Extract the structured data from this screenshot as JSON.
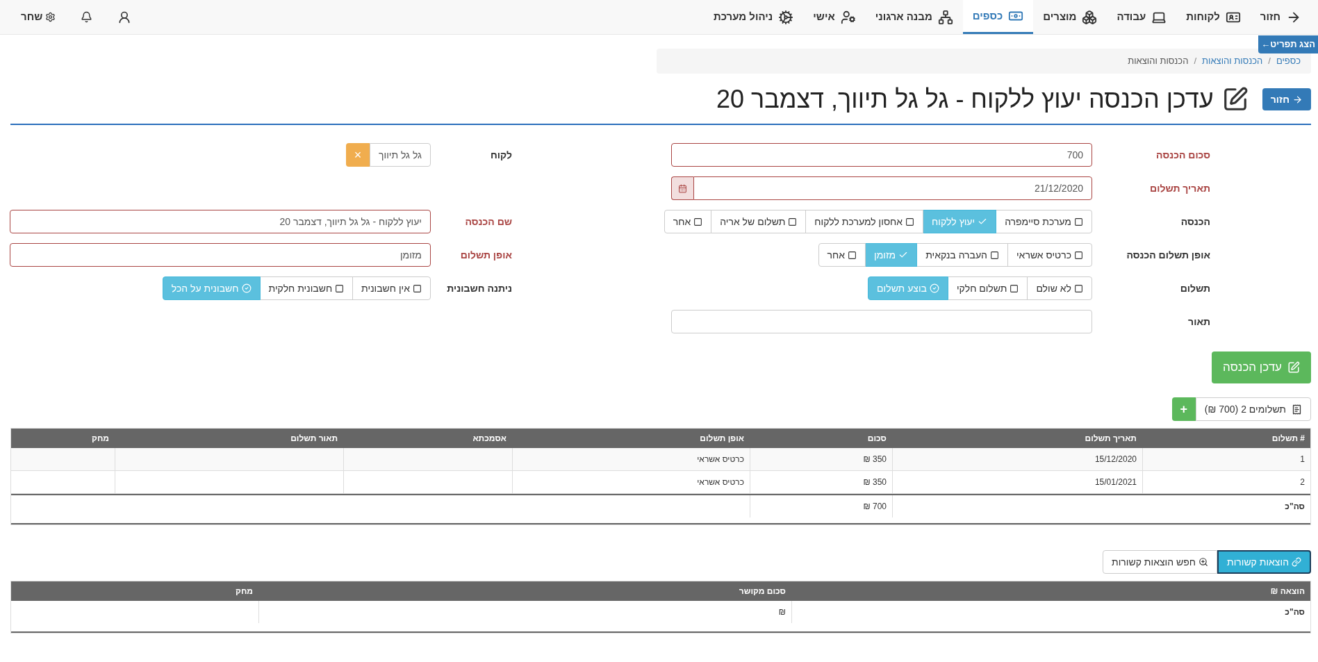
{
  "nav": {
    "items": [
      {
        "label": "חזור",
        "selected": false
      },
      {
        "label": "לקוחות",
        "selected": false
      },
      {
        "label": "עבודה",
        "selected": false
      },
      {
        "label": "מוצרים",
        "selected": false
      },
      {
        "label": "כספים",
        "selected": true
      },
      {
        "label": "מבנה ארגוני",
        "selected": false
      },
      {
        "label": "אישי",
        "selected": false
      },
      {
        "label": "ניהול מערכת",
        "selected": false
      }
    ],
    "user": "שחר"
  },
  "menu_tab": "הצג תפריט←",
  "breadcrumb": {
    "separator": "/",
    "items": [
      "כספים",
      "הכנסות והוצאות",
      "הכנסות והוצאות"
    ]
  },
  "back_button": "חזור",
  "title": "עדכן הכנסה יעוץ ללקוח - גל גל תיווך, דצמבר 20",
  "rows": [
    {
      "right": {
        "label": "סכום הכנסה",
        "required": true,
        "kind": "text",
        "value": "700"
      },
      "left": {
        "label": "לקוח",
        "required": false,
        "kind": "tag",
        "value": "גל גל תיווך",
        "remove": "×"
      }
    },
    {
      "right": {
        "label": "תאריך תשלום",
        "required": true,
        "kind": "date",
        "value": "21/12/2020"
      }
    },
    {
      "right": {
        "label": "הכנסה",
        "required": false,
        "kind": "toggle",
        "options": [
          {
            "label": "מערכת סיימפרה",
            "selected": false
          },
          {
            "label": "יעוץ ללקוח",
            "selected": true
          },
          {
            "label": "אחסון למערכת ללקוח",
            "selected": false
          },
          {
            "label": "תשלום של אריה",
            "selected": false
          },
          {
            "label": "אחר",
            "selected": false
          }
        ]
      },
      "left": {
        "label": "שם הכנסה",
        "required": true,
        "kind": "text",
        "value": "יעוץ ללקוח - גל גל תיווך, דצמבר 20"
      }
    },
    {
      "right": {
        "label": "אופן תשלום הכנסה",
        "required": false,
        "kind": "toggle",
        "options": [
          {
            "label": "כרטיס אשראי",
            "selected": false
          },
          {
            "label": "העברה בנקאית",
            "selected": false
          },
          {
            "label": "מזומן",
            "selected": true
          },
          {
            "label": "אחר",
            "selected": false
          }
        ]
      },
      "left": {
        "label": "אופן תשלום",
        "required": true,
        "kind": "text",
        "value": "מזומן"
      }
    },
    {
      "right": {
        "label": "תשלום",
        "required": false,
        "kind": "status",
        "options": [
          {
            "label": "לא שולם",
            "selected": false
          },
          {
            "label": "תשלום חלקי",
            "selected": false
          },
          {
            "label": "בוצע תשלום",
            "selected": true
          }
        ]
      },
      "left": {
        "label": "ניתנה חשבונית",
        "required": false,
        "kind": "status",
        "options": [
          {
            "label": "אין חשבונית",
            "selected": false
          },
          {
            "label": "חשבונית חלקית",
            "selected": false
          },
          {
            "label": "חשבונית על הכל",
            "selected": true
          }
        ]
      }
    },
    {
      "right": {
        "label": "תאור",
        "required": false,
        "kind": "text"
      }
    }
  ],
  "update_button": "עדכן הכנסה",
  "payments": {
    "button": "תשלומים 2 (700 ₪)",
    "add": "+",
    "columns": [
      "# תשלום",
      "תאריך תשלום",
      "סכום",
      "אופן תשלום",
      "אסמכתא",
      "תאור תשלום",
      "מחק"
    ],
    "rows": [
      [
        "1",
        "15/12/2020",
        "350 ₪",
        "כרטיס אשראי",
        null,
        null,
        null
      ],
      [
        "2",
        "15/01/2021",
        "350 ₪",
        "כרטיס אשראי",
        null,
        null,
        null
      ]
    ],
    "total": {
      "label": "סה\"כ",
      "amount": "700 ₪"
    }
  },
  "expenses": {
    "linked_button": "הוצאות קשורות",
    "search_button": "חפש הוצאות קשורות",
    "columns": [
      "הוצאה ₪",
      "סכום מקושר",
      "מחק"
    ],
    "total": {
      "label": "סה\"כ",
      "amount": "₪"
    }
  }
}
